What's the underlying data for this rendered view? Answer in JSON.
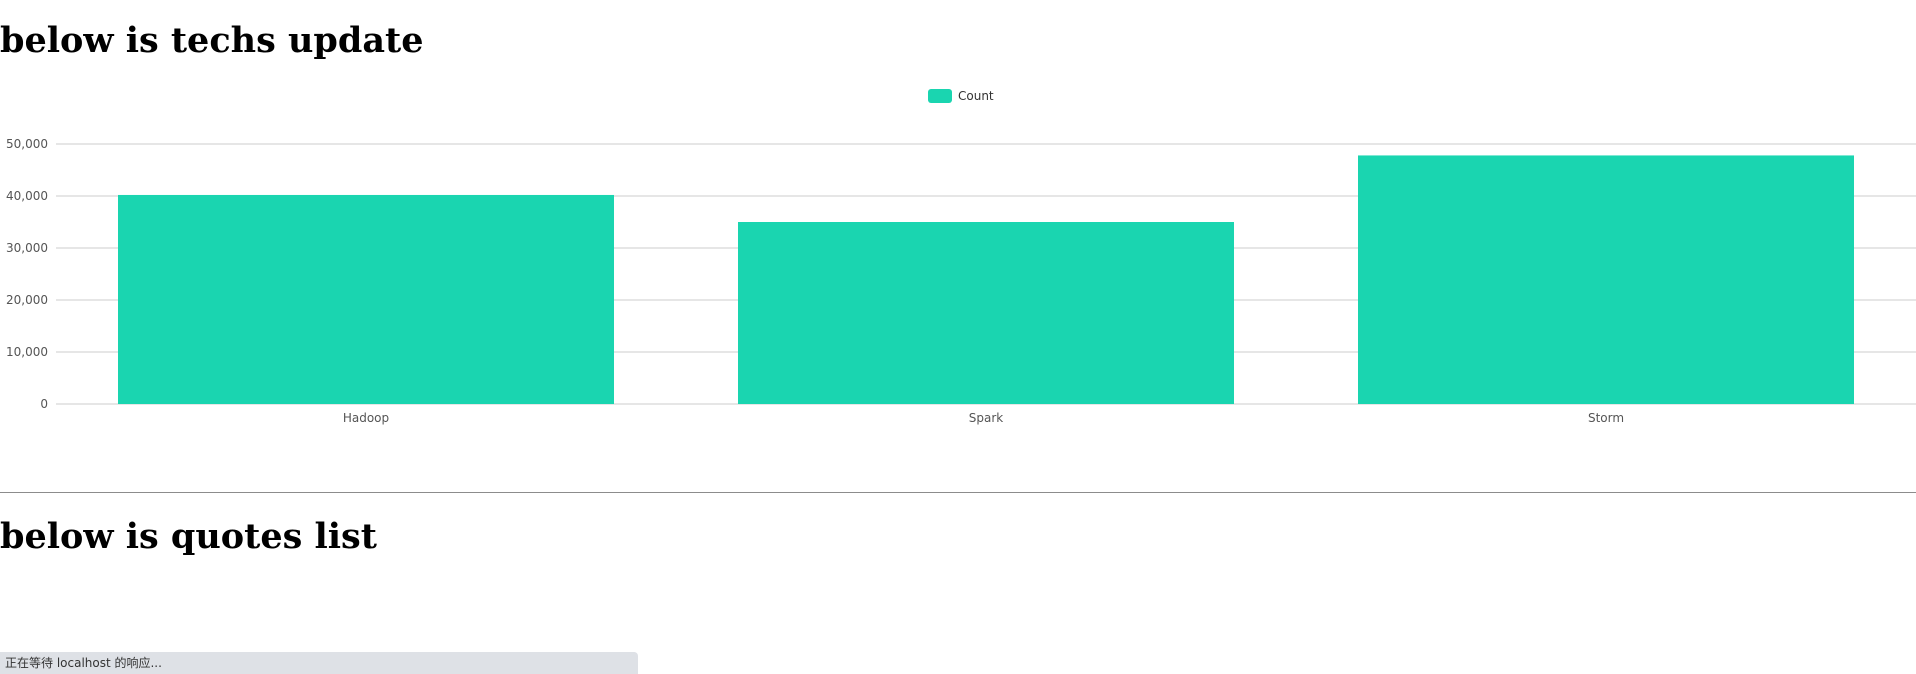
{
  "sections": {
    "techs_title": "below is techs update",
    "quotes_title": "below is quotes list"
  },
  "chart_data": {
    "type": "bar",
    "title": "",
    "xlabel": "",
    "ylabel": "",
    "categories": [
      "Hadoop",
      "Spark",
      "Storm"
    ],
    "series": [
      {
        "name": "Count",
        "values": [
          40200,
          35000,
          47800
        ],
        "color": "#1ad5b0"
      }
    ],
    "ylim": [
      0,
      50000
    ],
    "yticks": [
      0,
      10000,
      20000,
      30000,
      40000,
      50000
    ],
    "ytick_labels": [
      "0",
      "10,000",
      "20,000",
      "30,000",
      "40,000",
      "50,000"
    ],
    "grid": true,
    "legend_position": "top-center"
  },
  "status_bar": {
    "text": "正在等待 localhost 的响应..."
  },
  "colors": {
    "bar": "#1ad5b0",
    "grid": "#cccccc",
    "divider": "#8c8c8c",
    "status_bg": "#dee1e6"
  }
}
